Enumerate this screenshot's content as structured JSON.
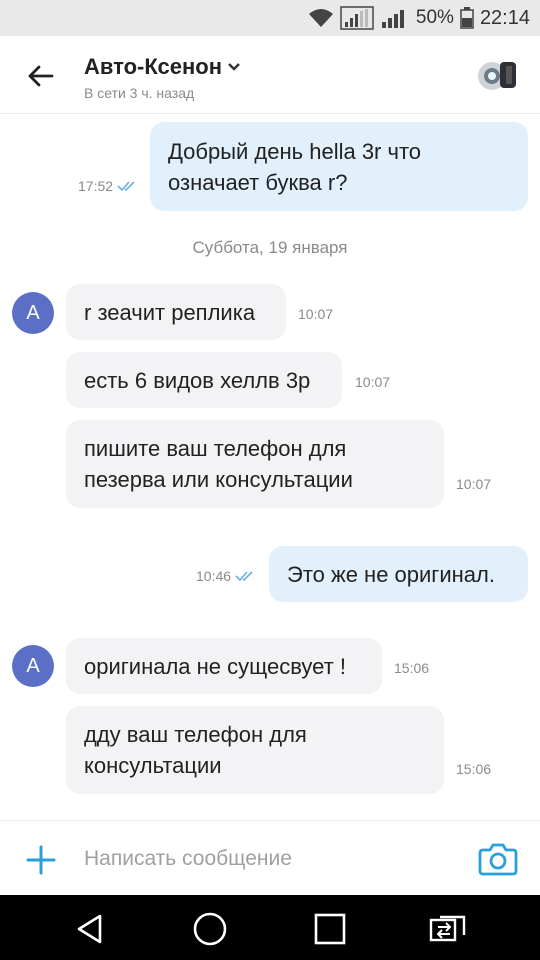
{
  "status_bar": {
    "battery": "50%",
    "time": "22:14",
    "wifi_icon": "wifi-icon",
    "signal_icon": "signal-icon",
    "battery_icon": "battery-icon"
  },
  "header": {
    "title": "Авто-Ксенон",
    "subtitle": "В сети 3 ч. назад"
  },
  "messages": [
    {
      "direction": "out",
      "lines": [
        "Добрый день hella 3r что",
        "означает буква r?"
      ],
      "time": "17:52",
      "read": true
    },
    {
      "direction": "in",
      "lines": [
        "r зеачит реплика"
      ],
      "time": "10:07"
    },
    {
      "direction": "in",
      "lines": [
        "есть 6 видов хеллв 3р"
      ],
      "time": "10:07"
    },
    {
      "direction": "in",
      "lines": [
        "пишите ваш телефон для",
        "пезерва или консультации"
      ],
      "time": "10:07"
    },
    {
      "direction": "out",
      "lines": [
        "Это же не оригинал."
      ],
      "time": "10:46",
      "read": true
    },
    {
      "direction": "in",
      "lines": [
        "оригинала не сущесвует !"
      ],
      "time": "15:06"
    },
    {
      "direction": "in",
      "lines": [
        "дду ваш телефон для",
        "консультации"
      ],
      "time": "15:06"
    }
  ],
  "date_separator": "Суббота, 19 января",
  "sender_initial": "A",
  "composer": {
    "placeholder": "Написать сообщение"
  },
  "colors": {
    "accent": "#2a9fd8",
    "incoming_bubble": "#f3f3f5",
    "outgoing_bubble": "#e1f0fb",
    "avatar": "#5b6fc7",
    "read_ticks": "#6ab0e6"
  }
}
